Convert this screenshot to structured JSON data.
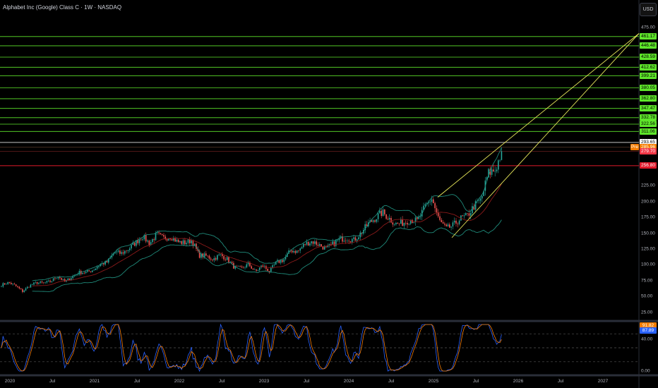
{
  "header": {
    "title": "Alphabet Inc (Google) Class C · 1W · NASDAQ",
    "currency_button": "USD"
  },
  "colors": {
    "up": "#26a69a",
    "down": "#ef5350",
    "level": "#5ee52a",
    "trend": "#e8e85a",
    "bb": "#1f8a7a",
    "ma": "#8b1a1a",
    "k": "#2962ff",
    "d": "#f57c00"
  },
  "chart_data": {
    "type": "candlestick",
    "title": "Alphabet Inc (Google) Class C · 1W · NASDAQ",
    "ylim": [
      0,
      480
    ],
    "y_ticks": [
      "475.00",
      "225.00",
      "200.00",
      "175.00",
      "150.00",
      "125.00",
      "100.00",
      "75.00",
      "50.00",
      "25.00"
    ],
    "x_ticks": [
      "2020",
      "Jul",
      "2021",
      "Jul",
      "2022",
      "Jul",
      "2023",
      "Jul",
      "2024",
      "Jul",
      "2025",
      "Jul",
      "2026",
      "Jul",
      "2027"
    ],
    "monthly_closes_from_dec_2019": [
      68,
      72,
      67,
      58,
      67,
      72,
      71,
      74,
      82,
      73,
      81,
      88,
      88,
      92,
      101,
      104,
      120,
      118,
      125,
      135,
      145,
      134,
      148,
      142,
      145,
      136,
      135,
      139,
      115,
      114,
      109,
      116,
      109,
      96,
      94,
      101,
      89,
      99,
      90,
      104,
      108,
      123,
      121,
      133,
      137,
      132,
      125,
      133,
      141,
      142,
      139,
      151,
      165,
      174,
      183,
      173,
      164,
      167,
      172,
      169,
      191,
      205,
      171,
      157,
      162,
      173,
      177,
      193,
      203,
      245,
      250,
      282
    ],
    "levels": [
      {
        "value": 461.17,
        "label": "461.17",
        "kind": "target"
      },
      {
        "value": 446.48,
        "label": "446.48",
        "kind": "target"
      },
      {
        "value": 428.59,
        "label": "428.59",
        "kind": "target"
      },
      {
        "value": 412.62,
        "label": "412.62",
        "kind": "target"
      },
      {
        "value": 399.21,
        "label": "399.21",
        "kind": "target"
      },
      {
        "value": 380.05,
        "label": "380.05",
        "kind": "target"
      },
      {
        "value": 362.8,
        "label": "362.80",
        "kind": "target"
      },
      {
        "value": 347.47,
        "label": "347.47",
        "kind": "target"
      },
      {
        "value": 332.78,
        "label": "332.78",
        "kind": "target"
      },
      {
        "value": 322.56,
        "label": "322.56",
        "kind": "target"
      },
      {
        "value": 311.06,
        "label": "311.06",
        "kind": "target"
      },
      {
        "value": 293.65,
        "label": "293.65",
        "kind": "high"
      },
      {
        "value": 285.96,
        "label": "285.96",
        "kind": "pre",
        "tag": "Pre"
      },
      {
        "value": 279.7,
        "label": "279.70",
        "kind": "last"
      },
      {
        "value": 256.8,
        "label": "256.80",
        "kind": "support"
      }
    ],
    "oscillator": {
      "labels": [
        "91.82",
        "87.89",
        "40.00",
        "0.00"
      ],
      "k_value": 87.89,
      "d_value": 91.82
    }
  }
}
